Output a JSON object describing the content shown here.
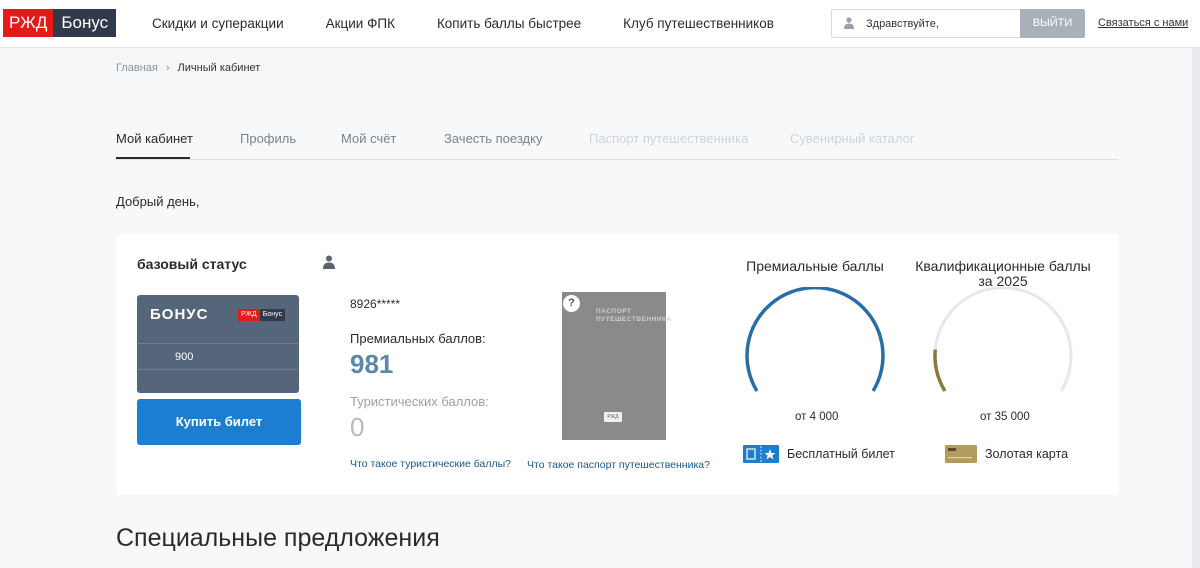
{
  "header": {
    "logo_rzd": "РЖД",
    "logo_bonus": "Бонус",
    "nav": [
      "Скидки и суперакции",
      "Акции ФПК",
      "Копить баллы быстрее",
      "Клуб путешественников"
    ],
    "login_placeholder": "Здравствуйте,",
    "login_button": "ВЫЙТИ",
    "contact_link": "Связаться с нами"
  },
  "breadcrumb": {
    "home": "Главная",
    "separator": "›",
    "current": "Личный кабинет"
  },
  "tabs": [
    {
      "label": "Мой кабинет",
      "state": "active"
    },
    {
      "label": "Профиль",
      "state": "normal"
    },
    {
      "label": "Мой счёт",
      "state": "normal"
    },
    {
      "label": "Зачесть поездку",
      "state": "normal"
    },
    {
      "label": "Паспорт путешественника",
      "state": "disabled"
    },
    {
      "label": "Сувенирный каталог",
      "state": "disabled"
    }
  ],
  "greeting": "Добрый день,",
  "account": {
    "status": "базовый статус",
    "card_title": "БОНУС",
    "card_logo_rzd": "РЖД",
    "card_logo_bonus": "Бонус",
    "card_number": "900",
    "buy_button": "Купить билет",
    "phone": "8926*****",
    "premium_label": "Премиальных баллов:",
    "premium_value": "981",
    "tourist_label": "Туристических баллов:",
    "tourist_value": "0",
    "tourist_link": "Что такое туристические баллы?",
    "passport_text": "ПАСПОРТ ПУТЕШЕСТВЕННИКА",
    "passport_emblem": "РЖД",
    "passport_help": "?",
    "passport_link": "Что такое паспорт путешественника?"
  },
  "gauges": [
    {
      "title": "Премиальные баллы",
      "threshold_label": "от 4 000",
      "progress": 1.0,
      "color": "#2a6da5",
      "award": "Бесплатный билет",
      "award_icon": "ticket-icon"
    },
    {
      "title": "Квалификационные баллы за 2025",
      "threshold_label": "от 35 000",
      "progress": 0.15,
      "color": "#8b7a3e",
      "award": "Золотая карта",
      "award_icon": "gold-card-icon"
    }
  ],
  "special_offers_title": "Специальные предложения"
}
